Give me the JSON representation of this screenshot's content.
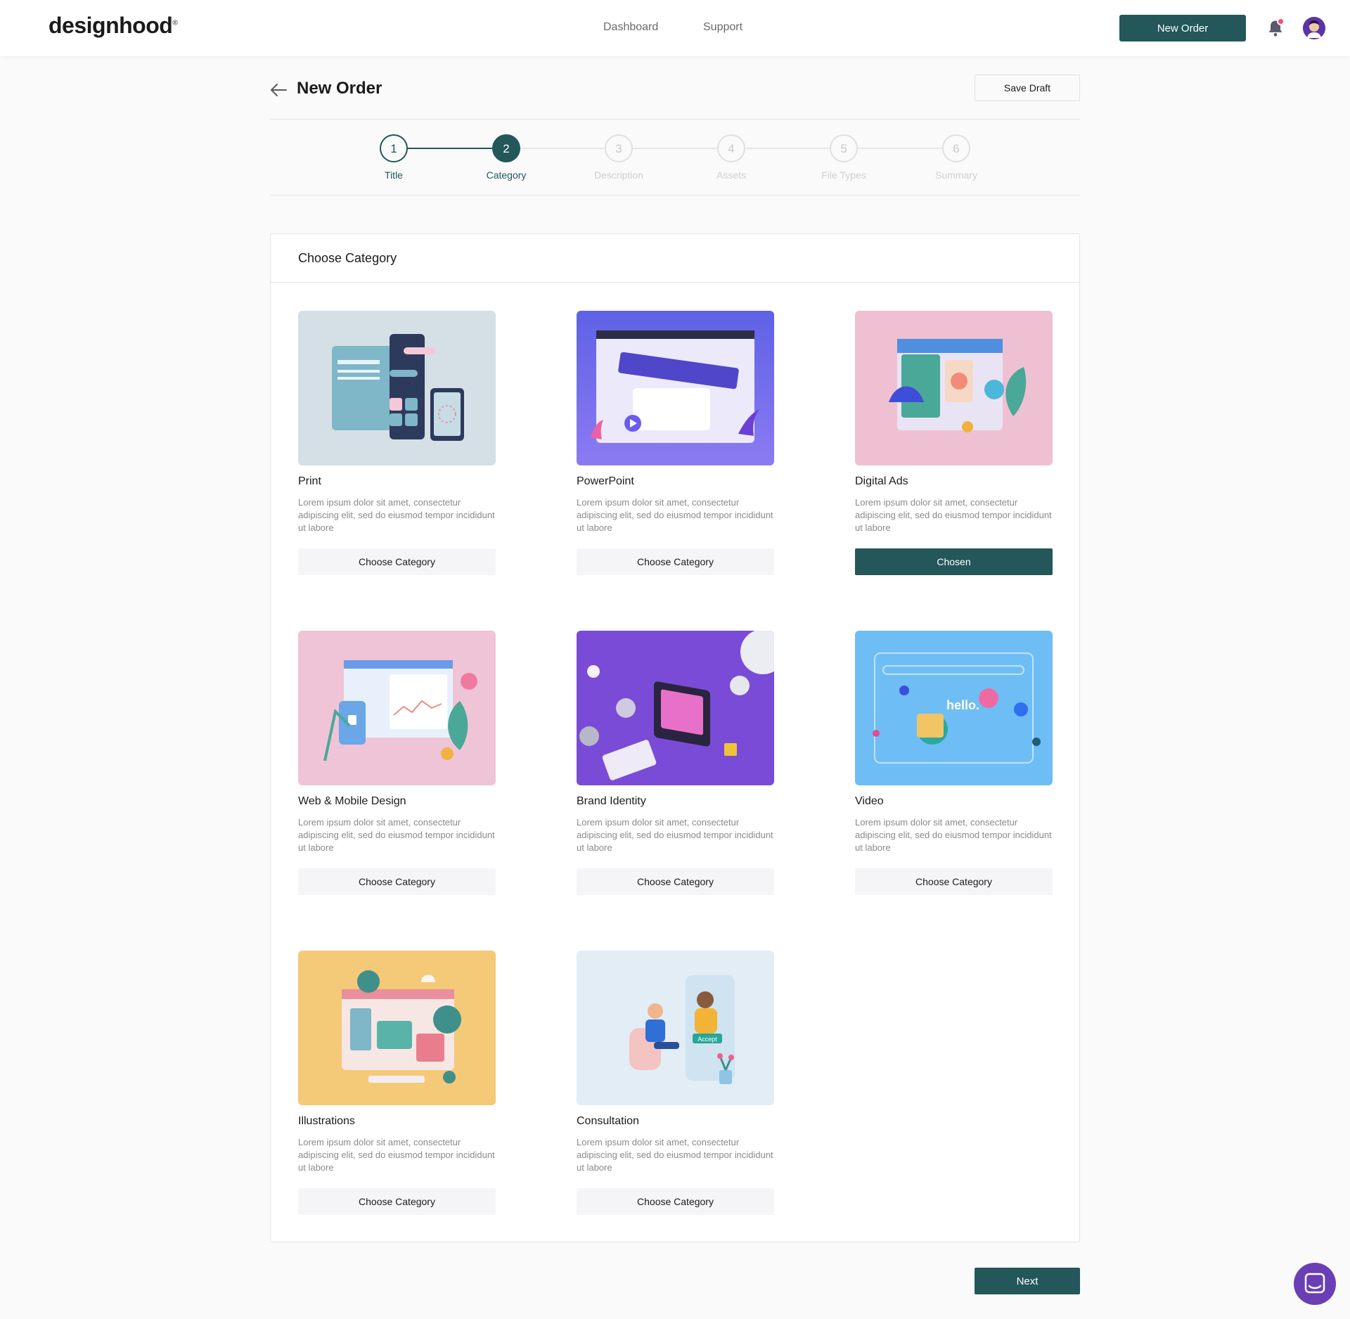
{
  "nav": {
    "logo": "designhood",
    "links": [
      "Dashboard",
      "Support"
    ],
    "new_order_label": "New Order"
  },
  "header": {
    "title": "New Order",
    "save_draft_label": "Save Draft"
  },
  "stepper": {
    "current_step": 2,
    "steps": [
      {
        "number": "1",
        "label": "Title",
        "state": "done"
      },
      {
        "number": "2",
        "label": "Category",
        "state": "active"
      },
      {
        "number": "3",
        "label": "Description",
        "state": "todo"
      },
      {
        "number": "4",
        "label": "Assets",
        "state": "todo"
      },
      {
        "number": "5",
        "label": "File Types",
        "state": "todo"
      },
      {
        "number": "6",
        "label": "Summary",
        "state": "todo"
      }
    ]
  },
  "panel": {
    "title": "Choose Category",
    "categories": [
      {
        "title": "Print",
        "description": "Lorem ipsum dolor sit amet, consectetur adipiscing elit, sed do eiusmod tempor incididunt ut labore",
        "button": "Choose Category",
        "chosen": false
      },
      {
        "title": "PowerPoint",
        "description": "Lorem ipsum dolor sit amet, consectetur adipiscing elit, sed do eiusmod tempor incididunt ut labore",
        "button": "Choose Category",
        "chosen": false
      },
      {
        "title": "Digital Ads",
        "description": "Lorem ipsum dolor sit amet, consectetur adipiscing elit, sed do eiusmod tempor incididunt ut labore",
        "button": "Chosen",
        "chosen": true
      },
      {
        "title": "Web & Mobile Design",
        "description": "Lorem ipsum dolor sit amet, consectetur adipiscing elit, sed do eiusmod tempor incididunt ut labore",
        "button": "Choose Category",
        "chosen": false
      },
      {
        "title": "Brand Identity",
        "description": "Lorem ipsum dolor sit amet, consectetur adipiscing elit, sed do eiusmod tempor incididunt ut labore",
        "button": "Choose Category",
        "chosen": false
      },
      {
        "title": "Video",
        "description": "Lorem ipsum dolor sit amet, consectetur adipiscing elit, sed do eiusmod tempor incididunt ut labore",
        "button": "Choose Category",
        "chosen": false
      },
      {
        "title": "Illustrations",
        "description": "Lorem ipsum dolor sit amet, consectetur adipiscing elit, sed do eiusmod tempor incididunt ut labore",
        "button": "Choose Category",
        "chosen": false
      },
      {
        "title": "Consultation",
        "description": "Lorem ipsum dolor sit amet, consectetur adipiscing elit, sed do eiusmod tempor incididunt ut labore",
        "button": "Choose Category",
        "chosen": false
      }
    ],
    "illustration_text": {
      "video": "hello.",
      "consultation": "Accept"
    }
  },
  "footer": {
    "next_label": "Next"
  },
  "icons": {
    "back": "back-arrow-icon",
    "notifications": "bell-icon",
    "avatar": "user-avatar",
    "chat": "chat-icon"
  },
  "colors": {
    "primary": "#23575a",
    "notification_dot": "#ff4d6a",
    "chat_launcher": "#6a3fb5",
    "button_muted": "#f5f5f7"
  }
}
